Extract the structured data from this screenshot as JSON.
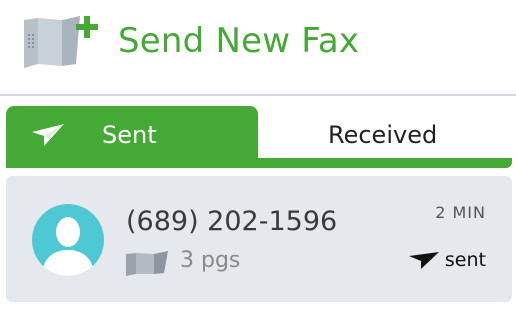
{
  "header": {
    "title": "Send New Fax",
    "icon": "fax-add-icon",
    "accent_color": "#45a935"
  },
  "tabs": [
    {
      "label": "Sent",
      "icon": "paper-plane-icon",
      "active": true
    },
    {
      "label": "Received",
      "active": false
    }
  ],
  "fax_list": [
    {
      "phone": "(689) 202-1596",
      "pages": "3 pgs",
      "time": "2 MIN",
      "status": "sent",
      "avatar": "user-avatar-icon",
      "pages_icon": "fax-pages-icon",
      "status_icon": "paper-plane-icon"
    }
  ]
}
